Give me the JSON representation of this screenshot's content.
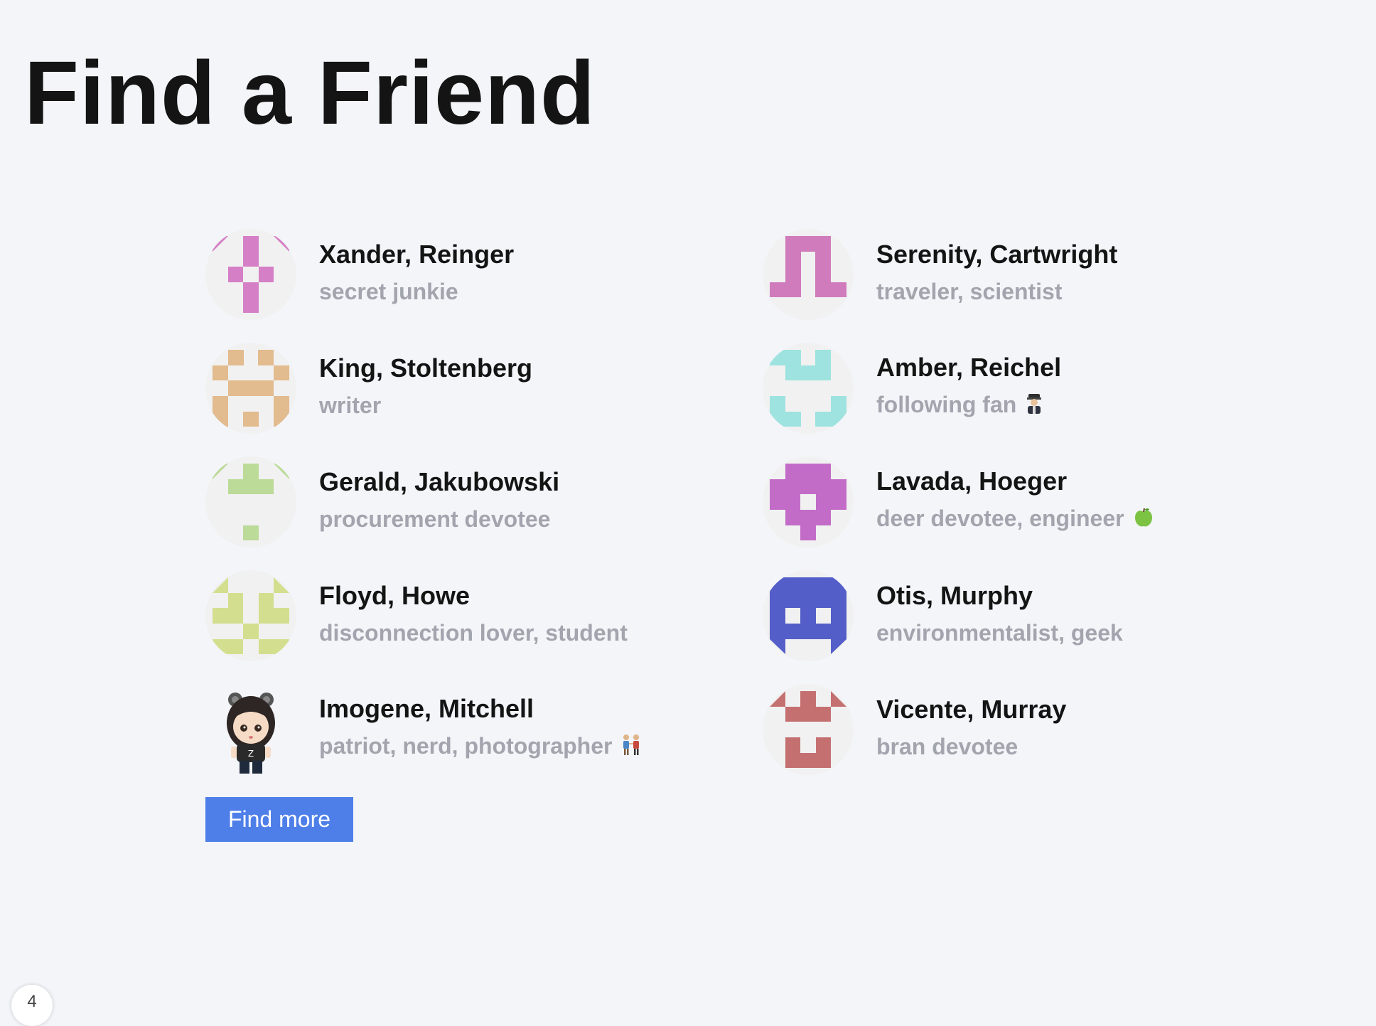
{
  "page": {
    "title": "Find a Friend"
  },
  "friends": [
    {
      "name": "Xander, Reinger",
      "tags": "secret junkie",
      "emoji": "",
      "avatar_color": "#d580c6",
      "avatar_pattern": "xander"
    },
    {
      "name": "Serenity, Cartwright",
      "tags": "traveler, scientist",
      "emoji": "",
      "avatar_color": "#d07bbc",
      "avatar_pattern": "serenity"
    },
    {
      "name": "King, Stoltenberg",
      "tags": "writer",
      "emoji": "",
      "avatar_color": "#e2bb8e",
      "avatar_pattern": "king"
    },
    {
      "name": "Amber, Reichel",
      "tags": "following fan",
      "emoji": "pilot-emoji",
      "avatar_color": "#9ee3df",
      "avatar_pattern": "amber"
    },
    {
      "name": "Gerald, Jakubowski",
      "tags": "procurement devotee",
      "emoji": "",
      "avatar_color": "#bcda98",
      "avatar_pattern": "gerald"
    },
    {
      "name": "Lavada, Hoeger",
      "tags": "deer devotee, engineer",
      "emoji": "green-apple-emoji",
      "avatar_color": "#c26cc8",
      "avatar_pattern": "lavada"
    },
    {
      "name": "Floyd, Howe",
      "tags": "disconnection lover, student",
      "emoji": "",
      "avatar_color": "#d3df8e",
      "avatar_pattern": "floyd"
    },
    {
      "name": "Otis, Murphy",
      "tags": "environmentalist, geek",
      "emoji": "",
      "avatar_color": "#545ec8",
      "avatar_pattern": "otis"
    },
    {
      "name": "Imogene, Mitchell",
      "tags": "patriot, nerd, photographer",
      "emoji": "couple-holding-hands-emoji",
      "avatar_color": "",
      "avatar_pattern": "photo"
    },
    {
      "name": "Vicente, Murray",
      "tags": "bran devotee",
      "emoji": "",
      "avatar_color": "#c57070",
      "avatar_pattern": "vicente"
    }
  ],
  "actions": {
    "find_more_label": "Find more"
  },
  "corner_badge": {
    "label": "4"
  }
}
